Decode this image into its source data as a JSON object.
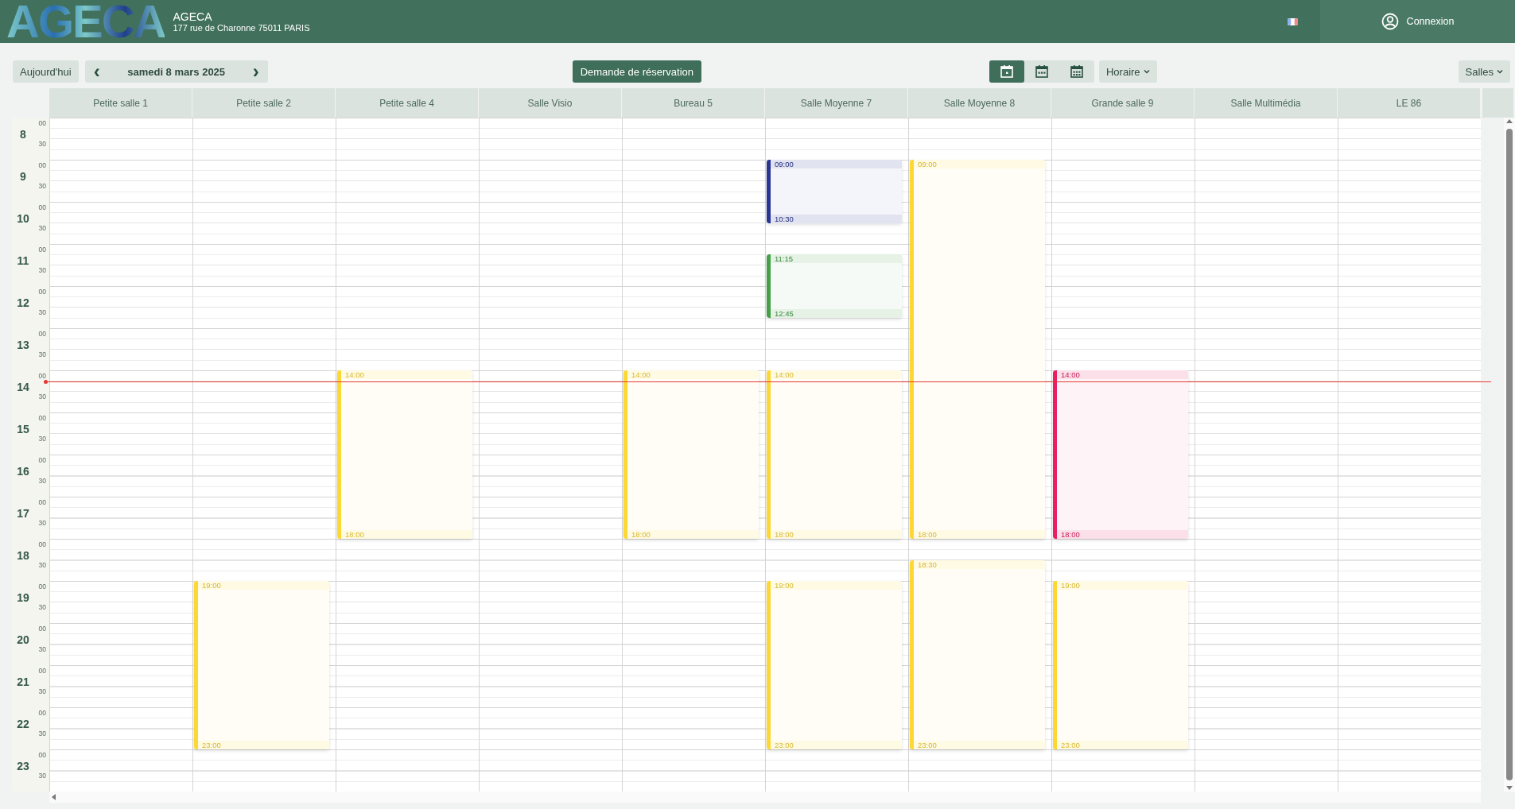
{
  "header": {
    "logo": "AGECA",
    "org_name": "AGECA",
    "address": "177 rue de Charonne 75011 PARIS",
    "login": "Connexion"
  },
  "toolbar": {
    "today": "Aujourd'hui",
    "date": "samedi 8 mars 2025",
    "prev": "‹",
    "next": "›",
    "request": "Demande de réservation",
    "views": [
      {
        "kind": "day",
        "selected": true
      },
      {
        "kind": "week",
        "selected": false
      },
      {
        "kind": "month",
        "selected": false
      }
    ],
    "mode": "Horaire",
    "resources": "Salles"
  },
  "hours": [
    {
      "hour": "8",
      "marks": [
        "00",
        "30"
      ],
      "current": false
    },
    {
      "hour": "9",
      "marks": [
        "00",
        "30"
      ],
      "current": false
    },
    {
      "hour": "10",
      "marks": [
        "00",
        "30"
      ],
      "current": false
    },
    {
      "hour": "11",
      "marks": [
        "00",
        "30"
      ],
      "current": false
    },
    {
      "hour": "12",
      "marks": [
        "00",
        "30"
      ],
      "current": false
    },
    {
      "hour": "13",
      "marks": [
        "00",
        "30"
      ],
      "current": false
    },
    {
      "hour": "14",
      "marks": [
        "00",
        "30"
      ],
      "current": true
    },
    {
      "hour": "15",
      "marks": [
        "00",
        "30"
      ],
      "current": false
    },
    {
      "hour": "16",
      "marks": [
        "00",
        "30"
      ],
      "current": false
    },
    {
      "hour": "17",
      "marks": [
        "00",
        "30"
      ],
      "current": false
    },
    {
      "hour": "18",
      "marks": [
        "00",
        "30"
      ],
      "current": false
    },
    {
      "hour": "19",
      "marks": [
        "00",
        "30"
      ],
      "current": false
    },
    {
      "hour": "20",
      "marks": [
        "00",
        "30"
      ],
      "current": false
    },
    {
      "hour": "21",
      "marks": [
        "00",
        "30"
      ],
      "current": false
    },
    {
      "hour": "22",
      "marks": [
        "00",
        "30"
      ],
      "current": false
    },
    {
      "hour": "23",
      "marks": [
        "00",
        "30"
      ],
      "current": false
    }
  ],
  "rooms": [
    {
      "name": "Petite salle 1"
    },
    {
      "name": "Petite salle 2",
      "events": [
        {
          "start": "19:00",
          "end": "23:00",
          "color": "#fdd835"
        }
      ]
    },
    {
      "name": "Petite salle 4",
      "events": [
        {
          "start": "14:00",
          "end": "18:00",
          "color": "#fdd835"
        }
      ]
    },
    {
      "name": "Salle Visio"
    },
    {
      "name": "Bureau 5",
      "events": [
        {
          "start": "14:00",
          "end": "18:00",
          "color": "#fdd835"
        }
      ]
    },
    {
      "name": "Salle Moyenne 7",
      "events": [
        {
          "start": "09:00",
          "end": "10:30",
          "color": "#283593"
        },
        {
          "start": "11:15",
          "end": "12:45",
          "color": "#43a047"
        },
        {
          "start": "14:00",
          "end": "18:00",
          "color": "#fdd835"
        },
        {
          "start": "19:00",
          "end": "23:00",
          "color": "#fdd835"
        }
      ]
    },
    {
      "name": "Salle Moyenne 8",
      "events": [
        {
          "start": "09:00",
          "end": "18:00",
          "color": "#fdd835"
        },
        {
          "start": "18:30",
          "end": "23:00",
          "color": "#fdd835"
        }
      ]
    },
    {
      "name": "Grande salle 9",
      "events": [
        {
          "start": "14:00",
          "end": "18:00",
          "color": "#e91e63"
        },
        {
          "start": "19:00",
          "end": "23:00",
          "color": "#fdd835"
        }
      ]
    },
    {
      "name": "Salle Multimédia"
    },
    {
      "name": "LE 86"
    }
  ]
}
